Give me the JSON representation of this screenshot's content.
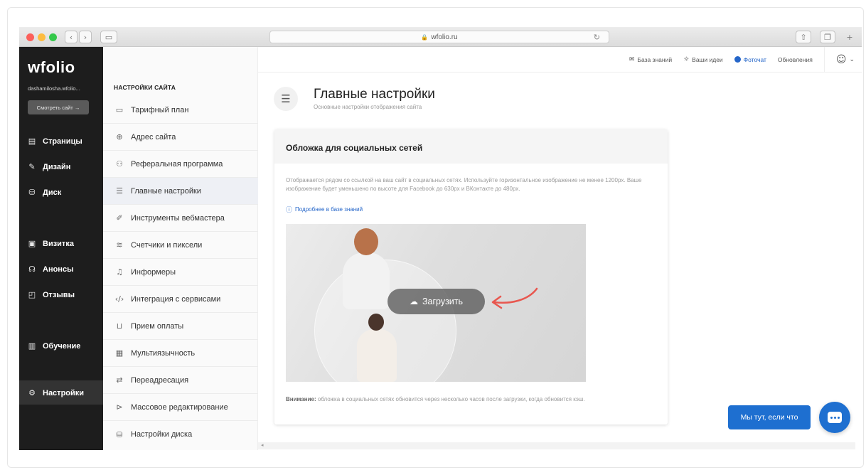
{
  "browser": {
    "url": "wfolio.ru",
    "back_icon": "‹",
    "forward_icon": "›"
  },
  "sidebar": {
    "logo": "wfolio",
    "email": "dashamilosha.wfolio...",
    "view_site": "Смотреть сайт →",
    "items": [
      {
        "label": "Страницы",
        "icon": "page-icon"
      },
      {
        "label": "Дизайн",
        "icon": "brush-icon"
      },
      {
        "label": "Диск",
        "icon": "disk-icon"
      },
      {
        "label": "Визитка",
        "icon": "card-icon"
      },
      {
        "label": "Анонсы",
        "icon": "megaphone-icon"
      },
      {
        "label": "Отзывы",
        "icon": "reviews-icon"
      },
      {
        "label": "Обучение",
        "icon": "book-icon"
      },
      {
        "label": "Настройки",
        "icon": "gear-icon"
      }
    ]
  },
  "submenu": {
    "title": "НАСТРОЙКИ САЙТА",
    "items": [
      {
        "label": "Тарифный план",
        "icon": "tariff-icon"
      },
      {
        "label": "Адрес сайта",
        "icon": "globe-icon"
      },
      {
        "label": "Реферальная программа",
        "icon": "referral-icon"
      },
      {
        "label": "Главные настройки",
        "icon": "sliders-icon"
      },
      {
        "label": "Инструменты вебмастера",
        "icon": "tools-icon"
      },
      {
        "label": "Счетчики и пиксели",
        "icon": "counter-icon"
      },
      {
        "label": "Информеры",
        "icon": "bell-icon"
      },
      {
        "label": "Интеграция с сервисами",
        "icon": "code-icon"
      },
      {
        "label": "Прием оплаты",
        "icon": "cart-icon"
      },
      {
        "label": "Мультиязычность",
        "icon": "language-icon"
      },
      {
        "label": "Переадресация",
        "icon": "redirect-icon"
      },
      {
        "label": "Массовое редактирование",
        "icon": "edit-icon"
      },
      {
        "label": "Настройки диска",
        "icon": "disk-settings-icon"
      }
    ]
  },
  "topnav": {
    "knowledge_base": "База знаний",
    "your_ideas": "Ваши идеи",
    "photochat": "Фоточат",
    "updates": "Обновления"
  },
  "main": {
    "title": "Главные настройки",
    "subtitle": "Основные настройки отображения сайта",
    "card": {
      "title": "Обложка для социальных сетей",
      "description": "Отображается рядом со ссылкой на ваш сайт в социальных сетях. Используйте горизонтальное изображение не менее 1200px. Ваше изображение будет уменьшено по высоте для Facebook до 630px и ВКонтакте до 480px.",
      "kb_link": "Подробнее в базе знаний",
      "upload": "Загрузить",
      "warning_label": "Внимание:",
      "warning_text": " обложка в социальных сетях обновится через несколько часов после загрузки, когда обновится кэш."
    }
  },
  "chat": {
    "label": "Мы тут, если что"
  },
  "colors": {
    "accent": "#1e6fd0",
    "sidebar_bg": "#1d1d1d",
    "arrow": "#e8574f"
  }
}
